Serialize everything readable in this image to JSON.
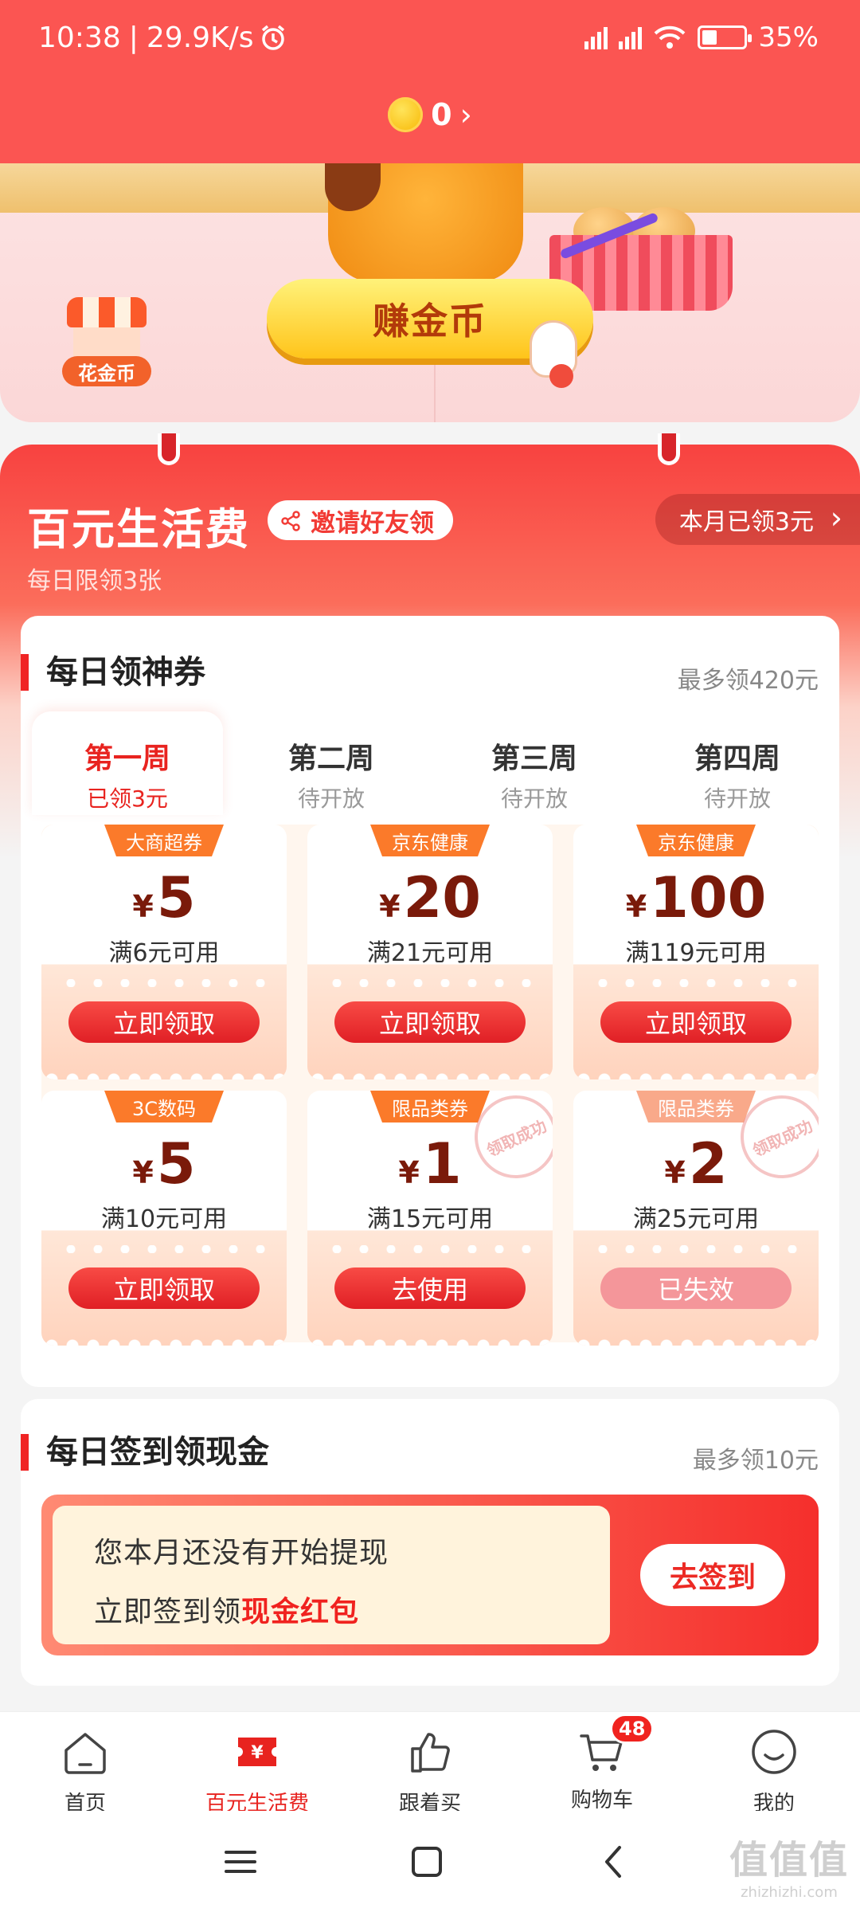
{
  "status": {
    "time": "10:38",
    "speed": "29.9K/s",
    "battery": "35%",
    "battery_level": 0.35
  },
  "header": {
    "coins": "0"
  },
  "banner": {
    "earn_label": "赚金币",
    "spend_label": "花金币"
  },
  "section": {
    "title": "百元生活费",
    "invite_label": "邀请好友领",
    "month_label": "本月已领3元",
    "daily_limit": "每日限领3张"
  },
  "coupons": {
    "title": "每日领神券",
    "max_note": "最多领420元",
    "weeks": [
      {
        "name": "第一周",
        "status": "已领3元"
      },
      {
        "name": "第二周",
        "status": "待开放"
      },
      {
        "name": "第三周",
        "status": "待开放"
      },
      {
        "name": "第四周",
        "status": "待开放"
      }
    ],
    "currency": "¥",
    "items": [
      {
        "tag": "大商超券",
        "amount": "5",
        "condition": "满6元可用",
        "button": "立即领取",
        "stamp": "",
        "disabled": false
      },
      {
        "tag": "京东健康",
        "amount": "20",
        "condition": "满21元可用",
        "button": "立即领取",
        "stamp": "",
        "disabled": false
      },
      {
        "tag": "京东健康",
        "amount": "100",
        "condition": "满119元可用",
        "button": "立即领取",
        "stamp": "",
        "disabled": false
      },
      {
        "tag": "3C数码",
        "amount": "5",
        "condition": "满10元可用",
        "button": "立即领取",
        "stamp": "",
        "disabled": false
      },
      {
        "tag": "限品类券",
        "amount": "1",
        "condition": "满15元可用",
        "button": "去使用",
        "stamp": "领取成功",
        "disabled": false
      },
      {
        "tag": "限品类券",
        "amount": "2",
        "condition": "满25元可用",
        "button": "已失效",
        "stamp": "领取成功",
        "disabled": true
      }
    ]
  },
  "signin": {
    "title": "每日签到领现金",
    "max_note": "最多领10元",
    "line1": "您本月还没有开始提现",
    "line2_prefix": "立即签到领",
    "line2_highlight": "现金红包",
    "button": "去签到"
  },
  "nav": {
    "items": [
      {
        "label": "首页",
        "icon": "home-icon"
      },
      {
        "label": "百元生活费",
        "icon": "ticket-icon"
      },
      {
        "label": "跟着买",
        "icon": "thumbs-up-icon"
      },
      {
        "label": "购物车",
        "icon": "cart-icon"
      },
      {
        "label": "我的",
        "icon": "smile-icon"
      }
    ],
    "cart_badge": "48"
  },
  "watermark": {
    "title": "值值值",
    "url": "zhizhizhi.com"
  },
  "colors": {
    "brand": "#fb5552",
    "accent": "#e8231f",
    "button_gold": "#ffc41a"
  }
}
